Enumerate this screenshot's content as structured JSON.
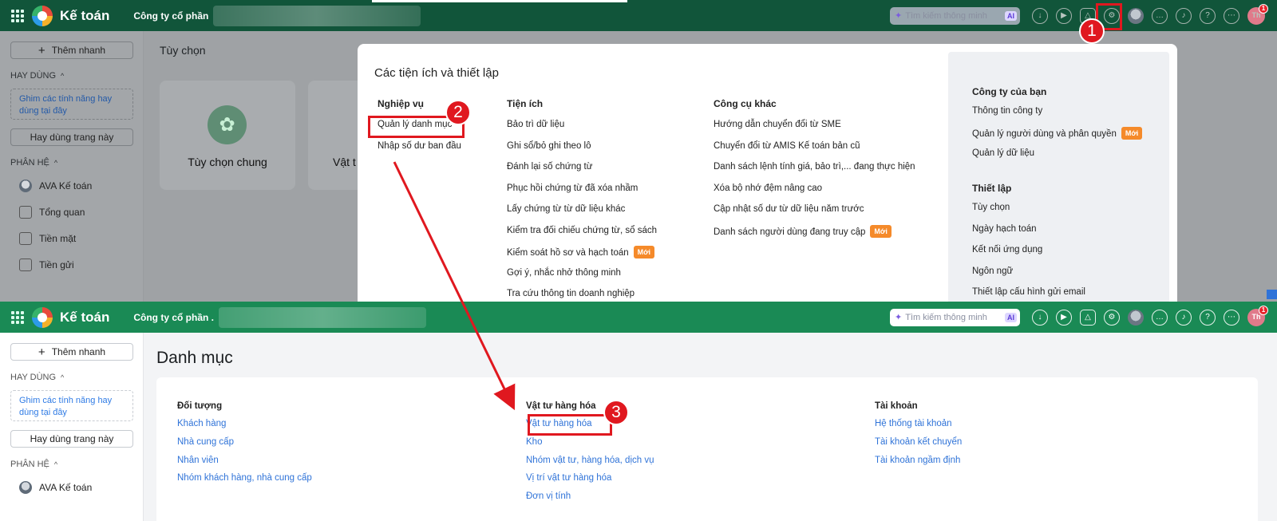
{
  "app": {
    "name": "Kế toán",
    "company": "Công ty cổ phần",
    "company_bottom": "Công ty cổ phần .",
    "search_placeholder": "Tìm kiếm thông minh",
    "ai_badge": "AI",
    "notification_count": "1",
    "user_initials": "Th"
  },
  "sidebar": {
    "add_label": "Thêm nhanh",
    "section_frequent": "HAY DÙNG",
    "pin_hint": "Ghim các tính năng hay dùng tại đây",
    "frequent_button": "Hay dùng trang này",
    "section_modules": "PHÂN HỆ",
    "items": [
      {
        "label": "AVA Kế toán",
        "icon": "ava-avatar-icon"
      },
      {
        "label": "Tổng quan",
        "icon": "dashboard-icon"
      },
      {
        "label": "Tiền mặt",
        "icon": "cash-icon"
      },
      {
        "label": "Tiền gửi",
        "icon": "bank-icon"
      }
    ]
  },
  "top_page": {
    "title": "Tùy chọn",
    "cards": [
      {
        "label": "Tùy chọn chung"
      },
      {
        "label": "Vật t"
      }
    ]
  },
  "popup": {
    "title": "Các tiện ích và thiết lập",
    "new_badge": "Mới",
    "columns": [
      {
        "heading": "Nghiệp vụ",
        "items": [
          "Quản lý danh mục",
          "Nhập số dư ban đầu"
        ]
      },
      {
        "heading": "Tiện ích",
        "items": [
          "Bảo trì dữ liệu",
          "Ghi sổ/bỏ ghi theo lô",
          "Đánh lại số chứng từ",
          "Phục hồi chứng từ đã xóa nhầm",
          "Lấy chứng từ từ dữ liệu khác",
          "Kiểm tra đối chiếu chứng từ, sổ sách",
          "Kiểm soát hồ sơ và hạch toán",
          "Gợi ý, nhắc nhở thông minh",
          "Tra cứu thông tin doanh nghiệp"
        ]
      },
      {
        "heading": "Công cụ khác",
        "items": [
          "Hướng dẫn chuyển đổi từ SME",
          "Chuyển đổi từ AMIS Kế toán bản cũ",
          "Danh sách lệnh tính giá, bảo trì,... đang thực hiện",
          "Xóa bộ nhớ đệm nâng cao",
          "Cập nhật số dư từ dữ liệu năm trước",
          "Danh sách người dùng đang truy cập"
        ]
      }
    ],
    "panel": {
      "company_heading": "Công ty của bạn",
      "company_items": [
        "Thông tin công ty",
        "Quản lý người dùng và phân quyền",
        "Quản lý dữ liệu"
      ],
      "setup_heading": "Thiết lập",
      "setup_items": [
        "Tùy chọn",
        "Ngày hạch toán",
        "Kết nối ứng dụng",
        "Ngôn ngữ",
        "Thiết lập cấu hình gửi email"
      ]
    }
  },
  "catalog": {
    "title": "Danh mục",
    "columns": [
      {
        "heading": "Đối tượng",
        "items": [
          "Khách hàng",
          "Nhà cung cấp",
          "Nhân viên",
          "Nhóm khách hàng, nhà cung cấp"
        ]
      },
      {
        "heading": "Vật tư hàng hóa",
        "items": [
          "Vật tư hàng hóa",
          "Kho",
          "Nhóm vật tư, hàng hóa, dịch vụ",
          "Vị trí vật tư hàng hóa",
          "Đơn vị tính"
        ]
      },
      {
        "heading": "Tài khoản",
        "items": [
          "Hệ thống tài khoản",
          "Tài khoản kết chuyển",
          "Tài khoản ngầm định"
        ]
      }
    ]
  },
  "annotations": {
    "step1": "1",
    "step2": "2",
    "step3": "3",
    "color": "#e0181f"
  }
}
